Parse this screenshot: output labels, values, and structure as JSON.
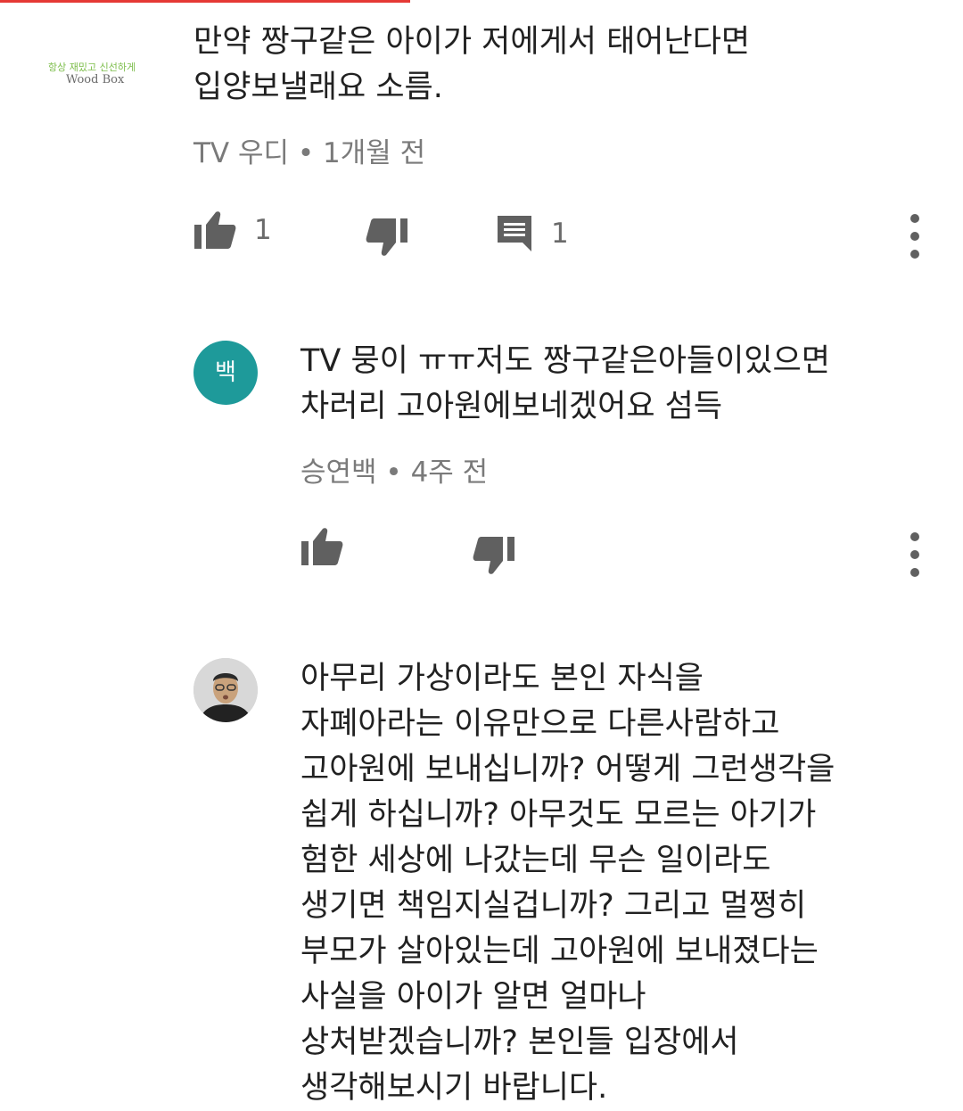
{
  "comments": [
    {
      "avatar": {
        "line1": "항상 재밌고 신선하게",
        "line2": "Wood Box"
      },
      "text": "만약 짱구같은 아이가 저에게서 태어난다면\n입양보낼래요 소름.",
      "author": "TV 우디",
      "time": "1개월 전",
      "likes": "1",
      "replies": "1",
      "icons": [
        "thumb-up-icon",
        "thumb-down-icon",
        "reply-comment-icon",
        "more-vert-icon"
      ]
    },
    {
      "avatar": {
        "letter": "백",
        "color": "#1e9a9a"
      },
      "text": "TV 뭉이 ㅠㅠ저도 짱구같은아들이있으면\n차러리 고아원에보네겠어요  섬득",
      "author": "승연백",
      "time": "4주 전",
      "icons": [
        "thumb-up-icon",
        "thumb-down-icon",
        "more-vert-icon"
      ]
    },
    {
      "avatar": {
        "kind": "photo"
      },
      "text": "아무리 가상이라도 본인 자식을\n자폐아라는 이유만으로 다른사람하고\n고아원에 보내십니까? 어떻게 그런생각을\n쉽게 하십니까? 아무것도 모르는 아기가\n험한 세상에 나갔는데 무슨 일이라도\n생기면 책임지실겁니까? 그리고 멀쩡히\n부모가 살아있는데 고아원에 보내졌다는\n사실을 아이가 알면 얼마나\n상처받겠습니까? 본인들 입장에서\n생각해보시기 바랍니다."
    }
  ],
  "separator": " • ",
  "colors": {
    "text": "#212121",
    "meta": "#7a7a7a",
    "icon": "#606060",
    "progress": "#e53935"
  }
}
